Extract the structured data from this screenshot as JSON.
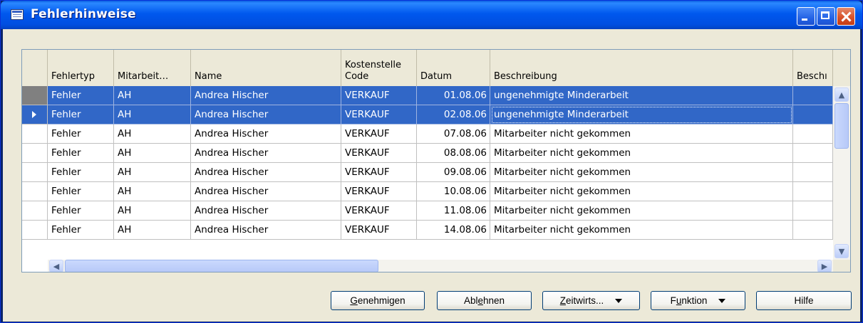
{
  "window": {
    "title": "Fehlerhinweise"
  },
  "table": {
    "columns": [
      {
        "key": "fehlertyp",
        "lines": [
          "",
          "Fehlertyp"
        ]
      },
      {
        "key": "mitarbeiter",
        "lines": [
          "",
          "Mitarbeit…"
        ]
      },
      {
        "key": "name",
        "lines": [
          "",
          "Name"
        ]
      },
      {
        "key": "kostenstelle",
        "lines": [
          "Kostenstelle",
          "Code"
        ]
      },
      {
        "key": "datum",
        "lines": [
          "",
          "Datum"
        ]
      },
      {
        "key": "beschreibung",
        "lines": [
          "",
          "Beschreibung"
        ]
      },
      {
        "key": "beschr2",
        "lines": [
          "",
          "Beschı"
        ]
      }
    ],
    "rows": [
      {
        "fehlertyp": "Fehler",
        "mitarbeiter": "AH",
        "name": "Andrea Hischer",
        "kostenstelle": "VERKAUF",
        "datum": "01.08.06",
        "beschreibung": "ungenehmigte Minderarbeit",
        "beschr2": ""
      },
      {
        "fehlertyp": "Fehler",
        "mitarbeiter": "AH",
        "name": "Andrea Hischer",
        "kostenstelle": "VERKAUF",
        "datum": "02.08.06",
        "beschreibung": "ungenehmigte Minderarbeit",
        "beschr2": ""
      },
      {
        "fehlertyp": "Fehler",
        "mitarbeiter": "AH",
        "name": "Andrea Hischer",
        "kostenstelle": "VERKAUF",
        "datum": "07.08.06",
        "beschreibung": "Mitarbeiter nicht gekommen",
        "beschr2": ""
      },
      {
        "fehlertyp": "Fehler",
        "mitarbeiter": "AH",
        "name": "Andrea Hischer",
        "kostenstelle": "VERKAUF",
        "datum": "08.08.06",
        "beschreibung": "Mitarbeiter nicht gekommen",
        "beschr2": ""
      },
      {
        "fehlertyp": "Fehler",
        "mitarbeiter": "AH",
        "name": "Andrea Hischer",
        "kostenstelle": "VERKAUF",
        "datum": "09.08.06",
        "beschreibung": "Mitarbeiter nicht gekommen",
        "beschr2": ""
      },
      {
        "fehlertyp": "Fehler",
        "mitarbeiter": "AH",
        "name": "Andrea Hischer",
        "kostenstelle": "VERKAUF",
        "datum": "10.08.06",
        "beschreibung": "Mitarbeiter nicht gekommen",
        "beschr2": ""
      },
      {
        "fehlertyp": "Fehler",
        "mitarbeiter": "AH",
        "name": "Andrea Hischer",
        "kostenstelle": "VERKAUF",
        "datum": "11.08.06",
        "beschreibung": "Mitarbeiter nicht gekommen",
        "beschr2": ""
      },
      {
        "fehlertyp": "Fehler",
        "mitarbeiter": "AH",
        "name": "Andrea Hischer",
        "kostenstelle": "VERKAUF",
        "datum": "14.08.06",
        "beschreibung": "Mitarbeiter nicht gekommen",
        "beschr2": ""
      }
    ]
  },
  "buttons": {
    "genehmigen": {
      "pre": "",
      "key": "G",
      "post": "enehmigen"
    },
    "ablehnen": {
      "pre": "Abl",
      "key": "e",
      "post": "hnen"
    },
    "zeitwirts": {
      "pre": "",
      "key": "Z",
      "post": "eitwirts..."
    },
    "funktion": {
      "pre": "F",
      "key": "u",
      "post": "nktion"
    },
    "hilfe": {
      "label": "Hilfe"
    }
  },
  "colors": {
    "selection": "#3167c7",
    "titlebar": "#0058ee",
    "face": "#ece9d8"
  }
}
